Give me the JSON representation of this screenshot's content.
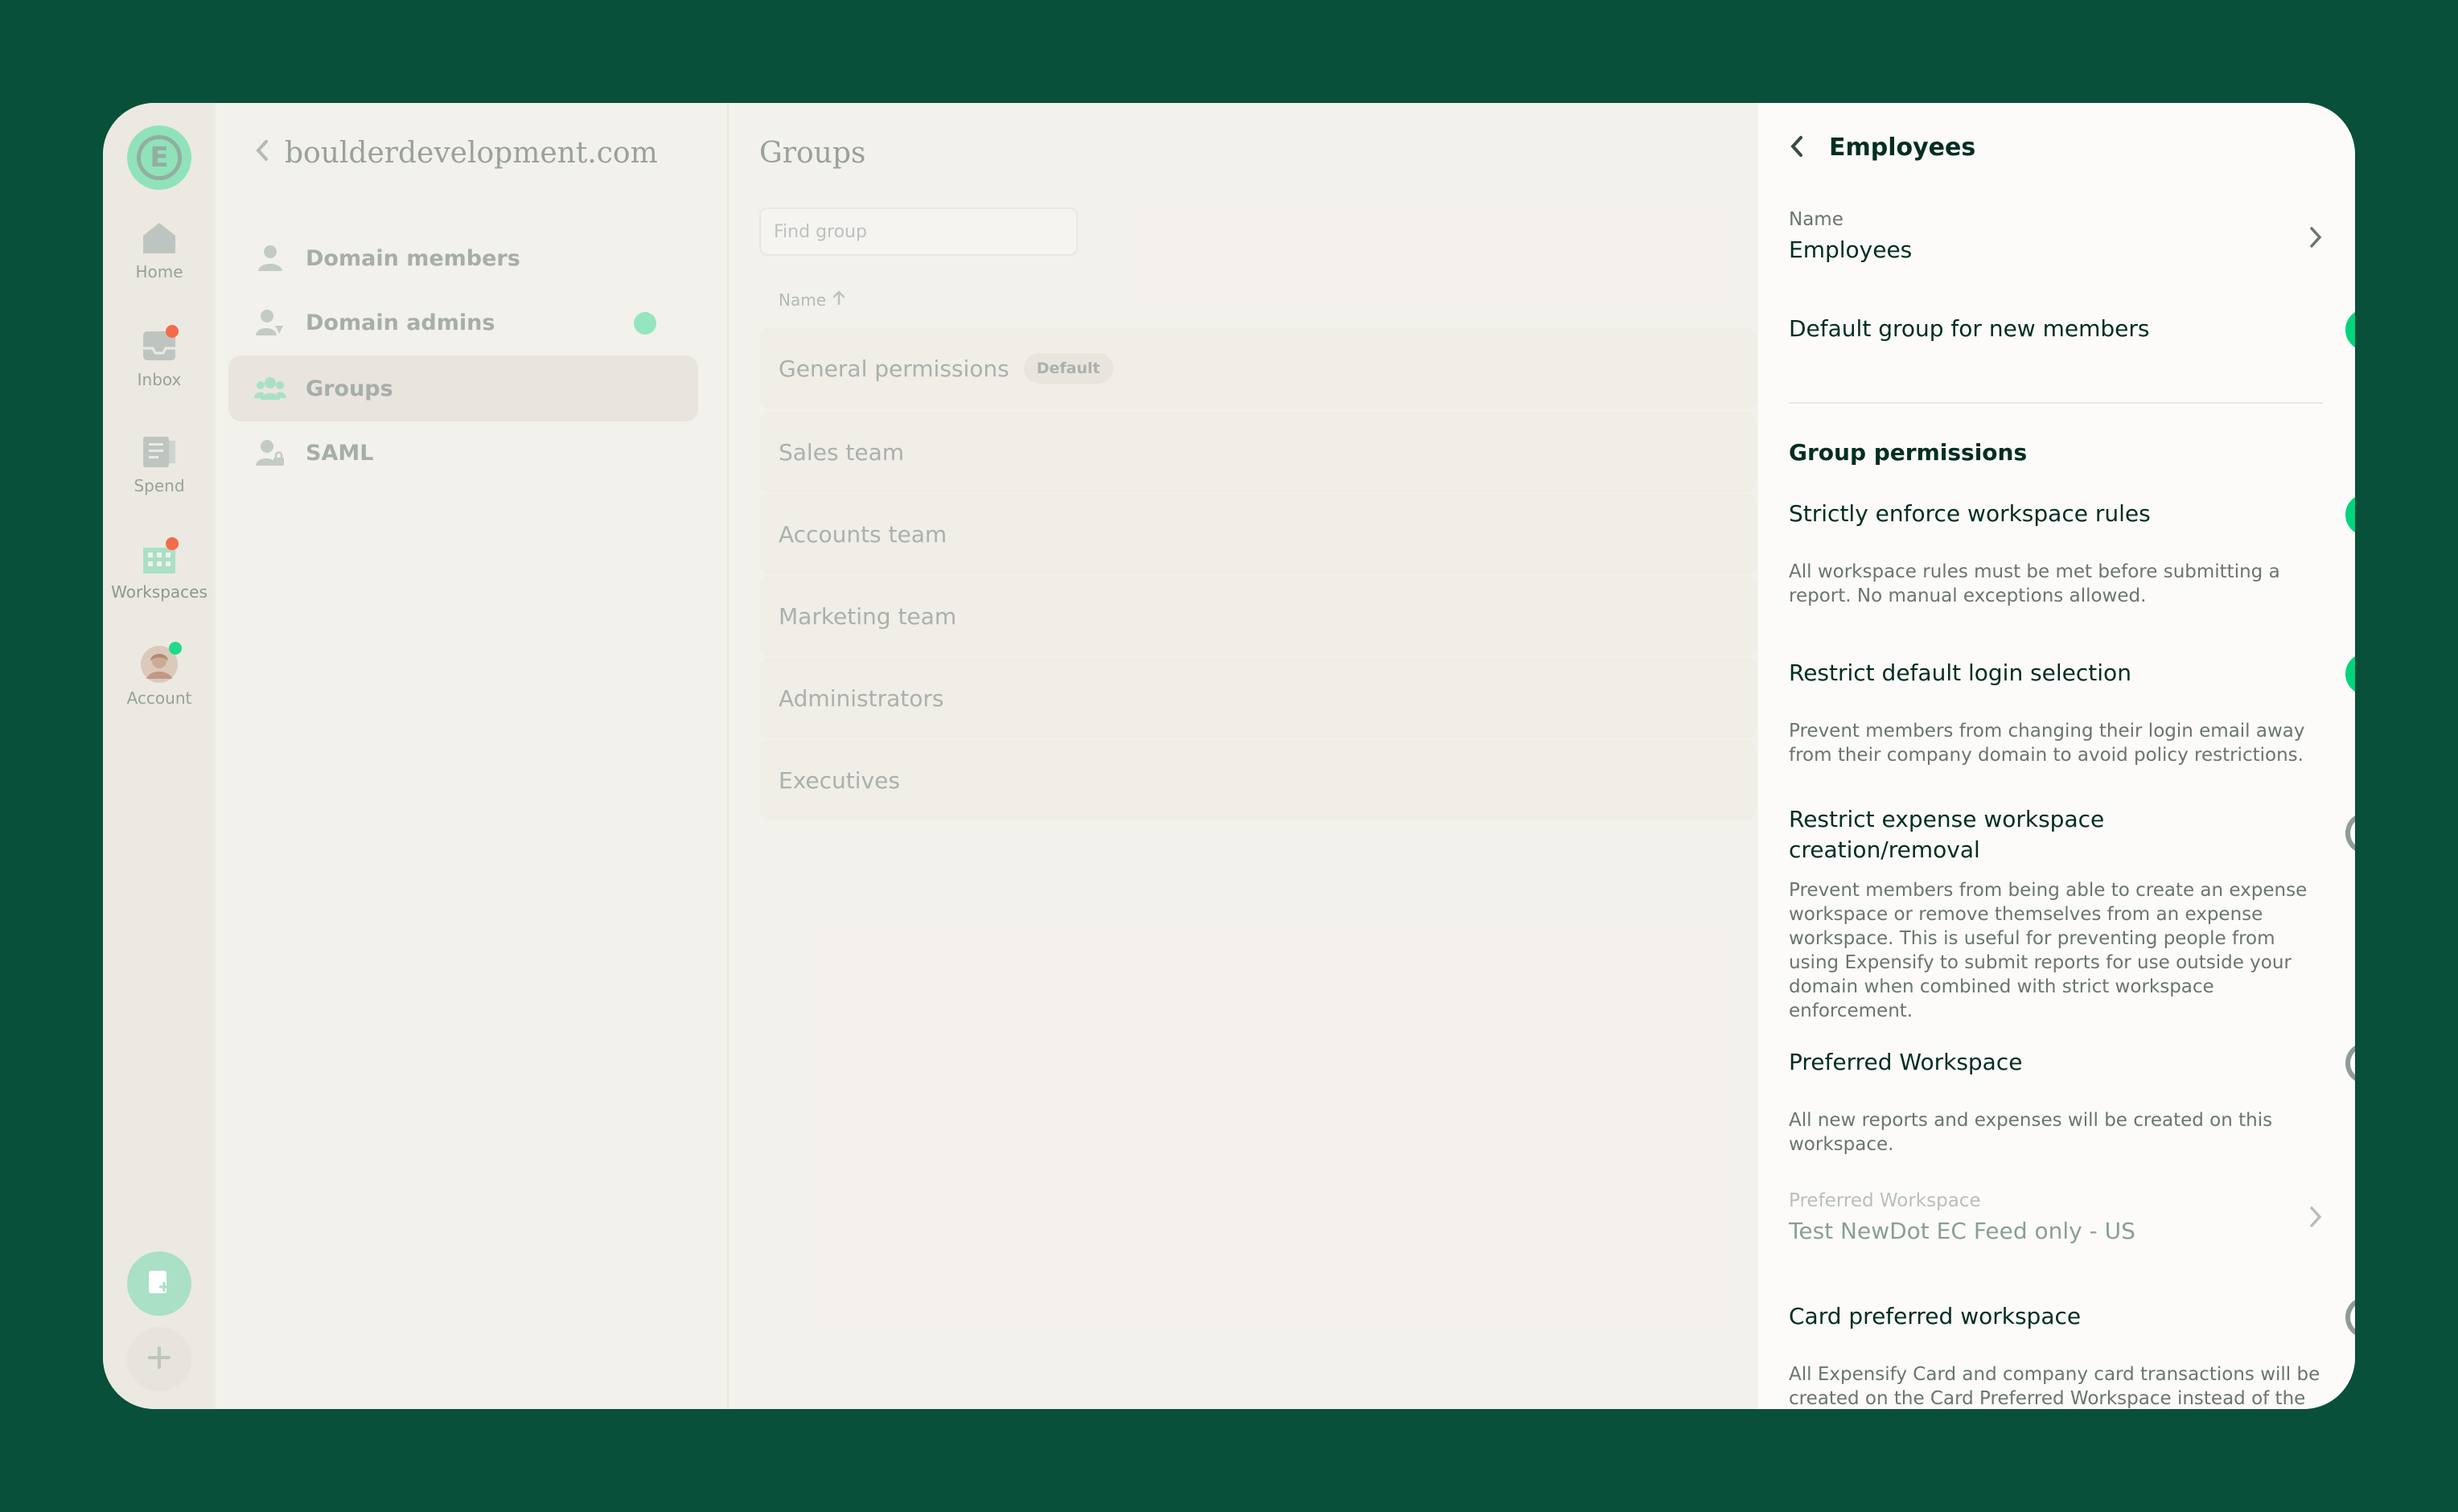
{
  "nav": {
    "logo_letter": "E",
    "items": [
      {
        "label": "Home",
        "icon": "home-icon"
      },
      {
        "label": "Inbox",
        "icon": "inbox-icon"
      },
      {
        "label": "Spend",
        "icon": "receipt-icon"
      },
      {
        "label": "Workspaces",
        "icon": "building-icon"
      },
      {
        "label": "Account",
        "icon": "avatar"
      }
    ]
  },
  "domain": {
    "title": "boulderdevelopment.com",
    "menu": [
      {
        "label": "Domain members",
        "icon": "person-icon"
      },
      {
        "label": "Domain admins",
        "icon": "user-admin-icon"
      },
      {
        "label": "Groups",
        "icon": "users-icon"
      },
      {
        "label": "SAML",
        "icon": "user-lock-icon"
      }
    ]
  },
  "groups": {
    "title": "Groups",
    "search_placeholder": "Find group",
    "column_header": "Name",
    "rows": [
      {
        "name": "General permissions",
        "badge": "Default"
      },
      {
        "name": "Sales team"
      },
      {
        "name": "Accounts team"
      },
      {
        "name": "Marketing team"
      },
      {
        "name": "Administrators"
      },
      {
        "name": "Executives"
      }
    ]
  },
  "panel": {
    "title": "Employees",
    "name_label": "Name",
    "name_value": "Employees",
    "default_group_label": "Default group for new members",
    "default_group_on": true,
    "section_title": "Group permissions",
    "permissions": [
      {
        "label": "Strictly enforce workspace rules",
        "on": true,
        "description": "All workspace rules must be met before submitting a report. No manual exceptions allowed."
      },
      {
        "label": "Restrict default login selection",
        "on": true,
        "description": "Prevent members from changing their login email away from their company domain to avoid policy restrictions."
      },
      {
        "label_line1": "Restrict expense workspace",
        "label_line2": "creation/removal",
        "on": false,
        "description": "Prevent members from being able to create an expense workspace or remove themselves from an expense workspace. This is useful for preventing people from using Expensify to submit reports for use outside your domain when combined with strict workspace enforcement."
      },
      {
        "label": "Preferred Workspace",
        "on": false,
        "description": "All new reports and expenses will be created on this workspace."
      },
      {
        "label": "Card preferred workspace",
        "on": false,
        "description": "All Expensify Card and company card transactions will be created on the Card Preferred Workspace instead of the"
      }
    ],
    "preferred_ws_label": "Preferred Workspace",
    "preferred_ws_value": "Test NewDot EC Feed only - US"
  },
  "colors": {
    "background": "#08503a",
    "accent_green": "#03d47c",
    "text_dark": "#002e22",
    "text_muted": "#6a7570",
    "toggle_off": "#8f9b97"
  }
}
